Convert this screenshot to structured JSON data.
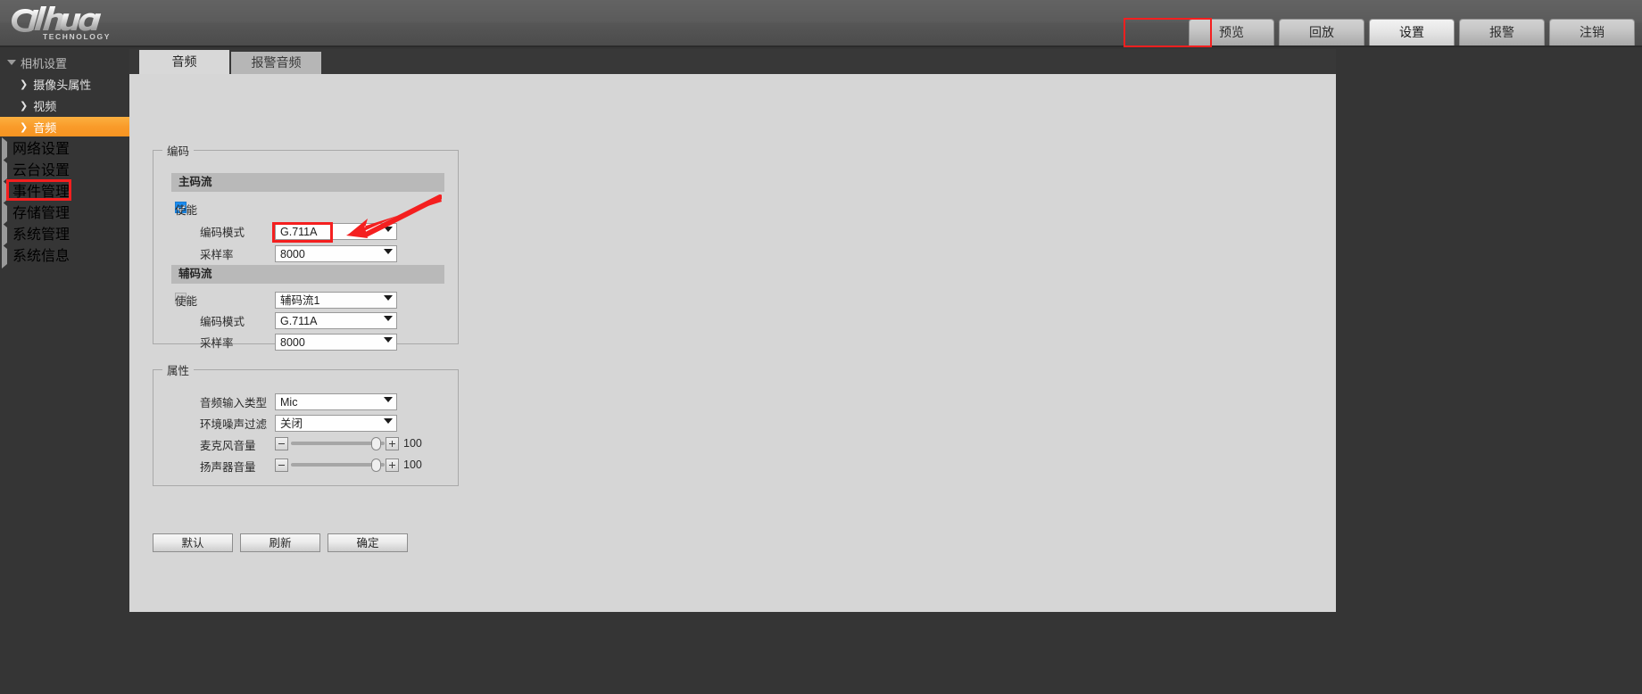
{
  "brand": {
    "logo_text": "alhua",
    "logo_sub": "TECHNOLOGY"
  },
  "nav": {
    "tabs": [
      {
        "label": "预览",
        "active": false
      },
      {
        "label": "回放",
        "active": false
      },
      {
        "label": "设置",
        "active": true
      },
      {
        "label": "报警",
        "active": false
      },
      {
        "label": "注销",
        "active": false
      }
    ],
    "highlight_color": "#f41f1f"
  },
  "sidebar": {
    "accent_color": "#f99b2a",
    "groups": [
      {
        "label": "相机设置",
        "expanded": true,
        "items": [
          {
            "label": "摄像头属性",
            "selected": false
          },
          {
            "label": "视频",
            "selected": false
          },
          {
            "label": "音频",
            "selected": true
          }
        ]
      },
      {
        "label": "网络设置",
        "expanded": false,
        "items": []
      },
      {
        "label": "云台设置",
        "expanded": false,
        "items": []
      },
      {
        "label": "事件管理",
        "expanded": false,
        "items": []
      },
      {
        "label": "存储管理",
        "expanded": false,
        "items": []
      },
      {
        "label": "系统管理",
        "expanded": false,
        "items": []
      },
      {
        "label": "系统信息",
        "expanded": false,
        "items": []
      }
    ]
  },
  "content_tabs": [
    {
      "label": "音频",
      "active": true
    },
    {
      "label": "报警音频",
      "active": false
    }
  ],
  "encode_section": {
    "legend": "编码",
    "main_stream": {
      "header": "主码流",
      "enable_label": "使能",
      "enable_checked": true,
      "mode_label": "编码模式",
      "mode_value": "G.711A",
      "samplerate_label": "采样率",
      "samplerate_value": "8000"
    },
    "sub_stream": {
      "header": "辅码流",
      "enable_label": "使能",
      "enable_checked": false,
      "stream_value": "辅码流1",
      "mode_label": "编码模式",
      "mode_value": "G.711A",
      "samplerate_label": "采样率",
      "samplerate_value": "8000"
    }
  },
  "attr_section": {
    "legend": "属性",
    "input_type_label": "音频输入类型",
    "input_type_value": "Mic",
    "noise_filter_label": "环境噪声过滤",
    "noise_filter_value": "关闭",
    "mic_volume_label": "麦克风音量",
    "mic_volume_value": "100",
    "speaker_volume_label": "扬声器音量",
    "speaker_volume_value": "100"
  },
  "buttons": [
    {
      "label": "默认"
    },
    {
      "label": "刷新"
    },
    {
      "label": "确定"
    }
  ],
  "annotations": {
    "encode_mode_box_color": "#f41f1f",
    "arrow_color": "#f41f1f",
    "sidebar_box_color": "#f41f1f"
  }
}
